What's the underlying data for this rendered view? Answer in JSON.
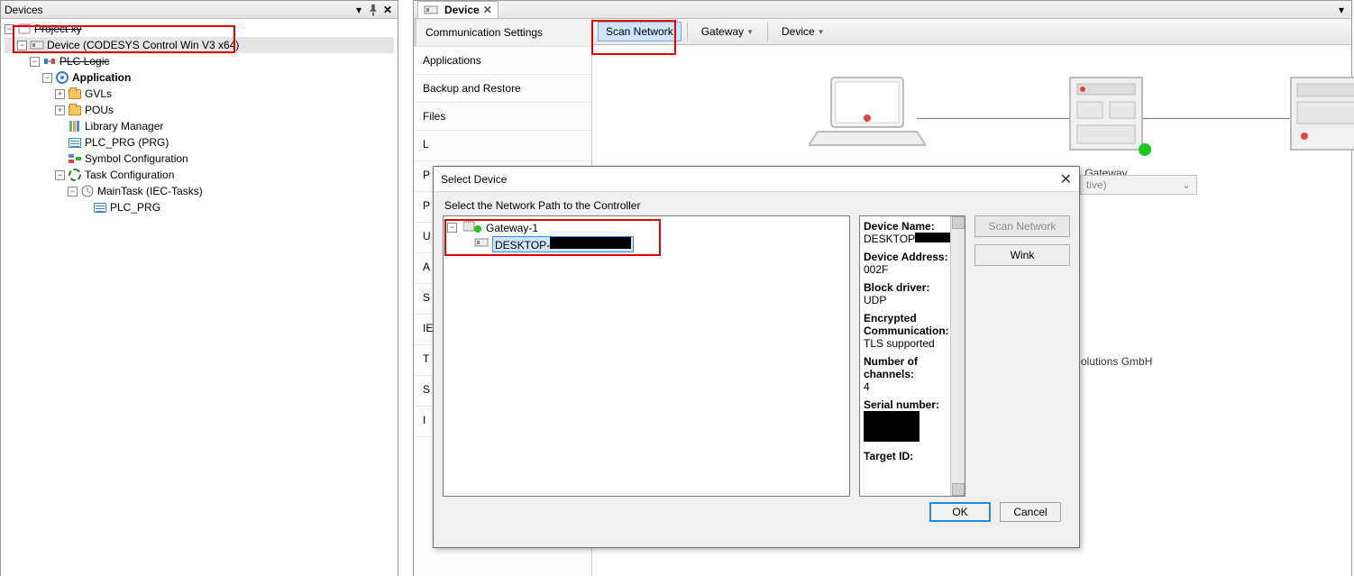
{
  "devices_panel": {
    "title": "Devices",
    "tree": {
      "project": "Project xy",
      "device": "Device (CODESYS Control Win V3 x64)",
      "plc_logic": "PLC Logic",
      "application": "Application",
      "gvls": "GVLs",
      "pous": "POUs",
      "library_manager": "Library Manager",
      "plc_prg": "PLC_PRG (PRG)",
      "symbol_config": "Symbol Configuration",
      "task_config": "Task Configuration",
      "maintask": "MainTask (IEC-Tasks)",
      "plc_prg2": "PLC_PRG"
    }
  },
  "right_panel": {
    "tab_label": "Device",
    "toolbar": {
      "scan_network": "Scan Network",
      "gateway": "Gateway",
      "device": "Device"
    },
    "side_nav": {
      "comm": "Communication Settings",
      "apps": "Applications",
      "backup": "Backup and Restore",
      "files": "Files",
      "l": "L",
      "p": "P",
      "p2": "P",
      "u": "U",
      "a": "A",
      "s": "S",
      "ie": "IE",
      "t": "T",
      "s2": "S",
      "i": "I"
    },
    "topology": {
      "gateway_label": "Gateway"
    },
    "combo_text": "tive)",
    "company": "olutions GmbH"
  },
  "dialog": {
    "title": "Select Device",
    "label": "Select the Network Path to the Controller",
    "tree": {
      "gateway": "Gateway-1",
      "desktop_prefix": "DESKTOP-"
    },
    "info": {
      "device_name_k": "Device Name:",
      "device_name_v_prefix": "DESKTOP",
      "device_addr_k": "Device Address:",
      "device_addr_v": "002F",
      "block_driver_k": "Block driver:",
      "block_driver_v": "UDP",
      "enc_comm_k": "Encrypted Communication:",
      "enc_comm_v": "TLS supported",
      "channels_k": "Number of channels:",
      "channels_v": "4",
      "serial_k": "Serial number:",
      "target_k": "Target ID:"
    },
    "buttons": {
      "scan": "Scan Network",
      "wink": "Wink",
      "ok": "OK",
      "cancel": "Cancel"
    }
  }
}
